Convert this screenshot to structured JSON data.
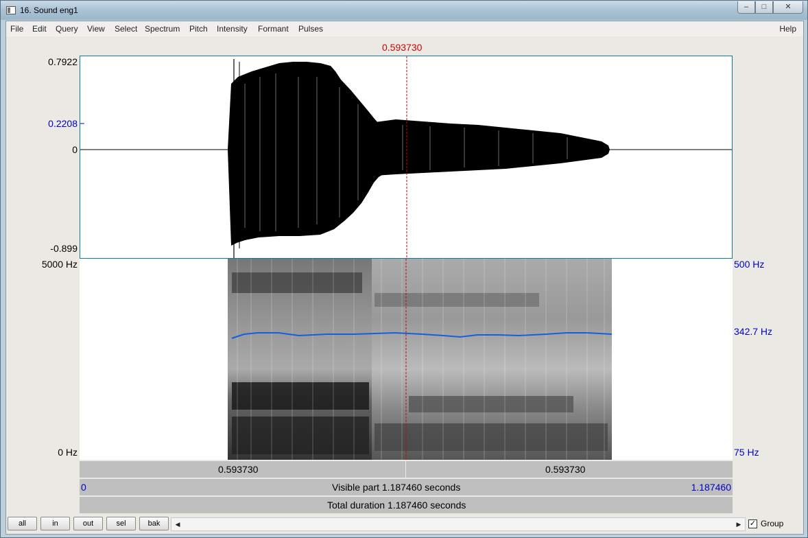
{
  "window": {
    "title": "16. Sound eng1",
    "controls": {
      "minimize": "–",
      "maximize": "□",
      "close": "✕"
    }
  },
  "menu": {
    "items": [
      "File",
      "Edit",
      "Query",
      "View",
      "Select",
      "Spectrum",
      "Pitch",
      "Intensity",
      "Formant",
      "Pulses"
    ],
    "help": "Help"
  },
  "cursor": {
    "time": "0.593730"
  },
  "waveform": {
    "y_max": "0.7922",
    "y_cursor": "0.2208",
    "y_zero": "0",
    "y_min": "-0.899"
  },
  "spectrogram": {
    "freq_max": "5000 Hz",
    "freq_min": "0 Hz",
    "pitch_max": "500 Hz",
    "pitch_cursor": "342.7 Hz",
    "pitch_min": "75 Hz"
  },
  "colors": {
    "pitch_line": "#1060e0",
    "cursor": "#d40000",
    "axis_blue": "#0000c8"
  },
  "time_bar": {
    "left_segment": "0.593730",
    "right_segment": "0.593730"
  },
  "visible_bar": {
    "start": "0",
    "label": "Visible part 1.187460 seconds",
    "end": "1.187460"
  },
  "total_bar": {
    "label": "Total duration 1.187460 seconds"
  },
  "bottom": {
    "buttons": [
      "all",
      "in",
      "out",
      "sel",
      "bak"
    ],
    "scroll_left": "◀",
    "scroll_right": "▶",
    "group_label": "Group",
    "group_checked": true
  }
}
